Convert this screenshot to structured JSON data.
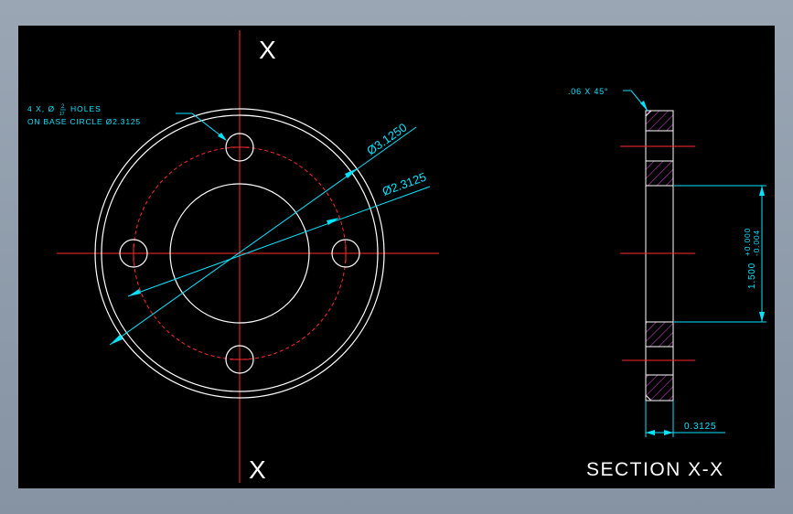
{
  "drawing": {
    "section_label_top": "X",
    "section_label_bottom": "X",
    "section_title": "SECTION X-X",
    "holes_note_line1_prefix": "4 X, Ø",
    "holes_note_fraction_num": "2",
    "holes_note_fraction_den": "17",
    "holes_note_line1_suffix": "HOLES",
    "holes_note_line2": "ON BASE CIRCLE Ø2.3125",
    "dim_outer_diameter": "Ø3.1250",
    "dim_base_circle": "Ø2.3125",
    "chamfer_note": ".06 X 45°",
    "dim_bore": "1.500",
    "tol_upper": "+0.000",
    "tol_lower": "-0.004",
    "dim_thickness": "0.3125"
  },
  "colors": {
    "background": "#000000",
    "frame": "#8a97a6",
    "geometry": "#ffffff",
    "centerline": "#ff2a2a",
    "dimension": "#00e5ff",
    "hatch": "#c040c0"
  }
}
